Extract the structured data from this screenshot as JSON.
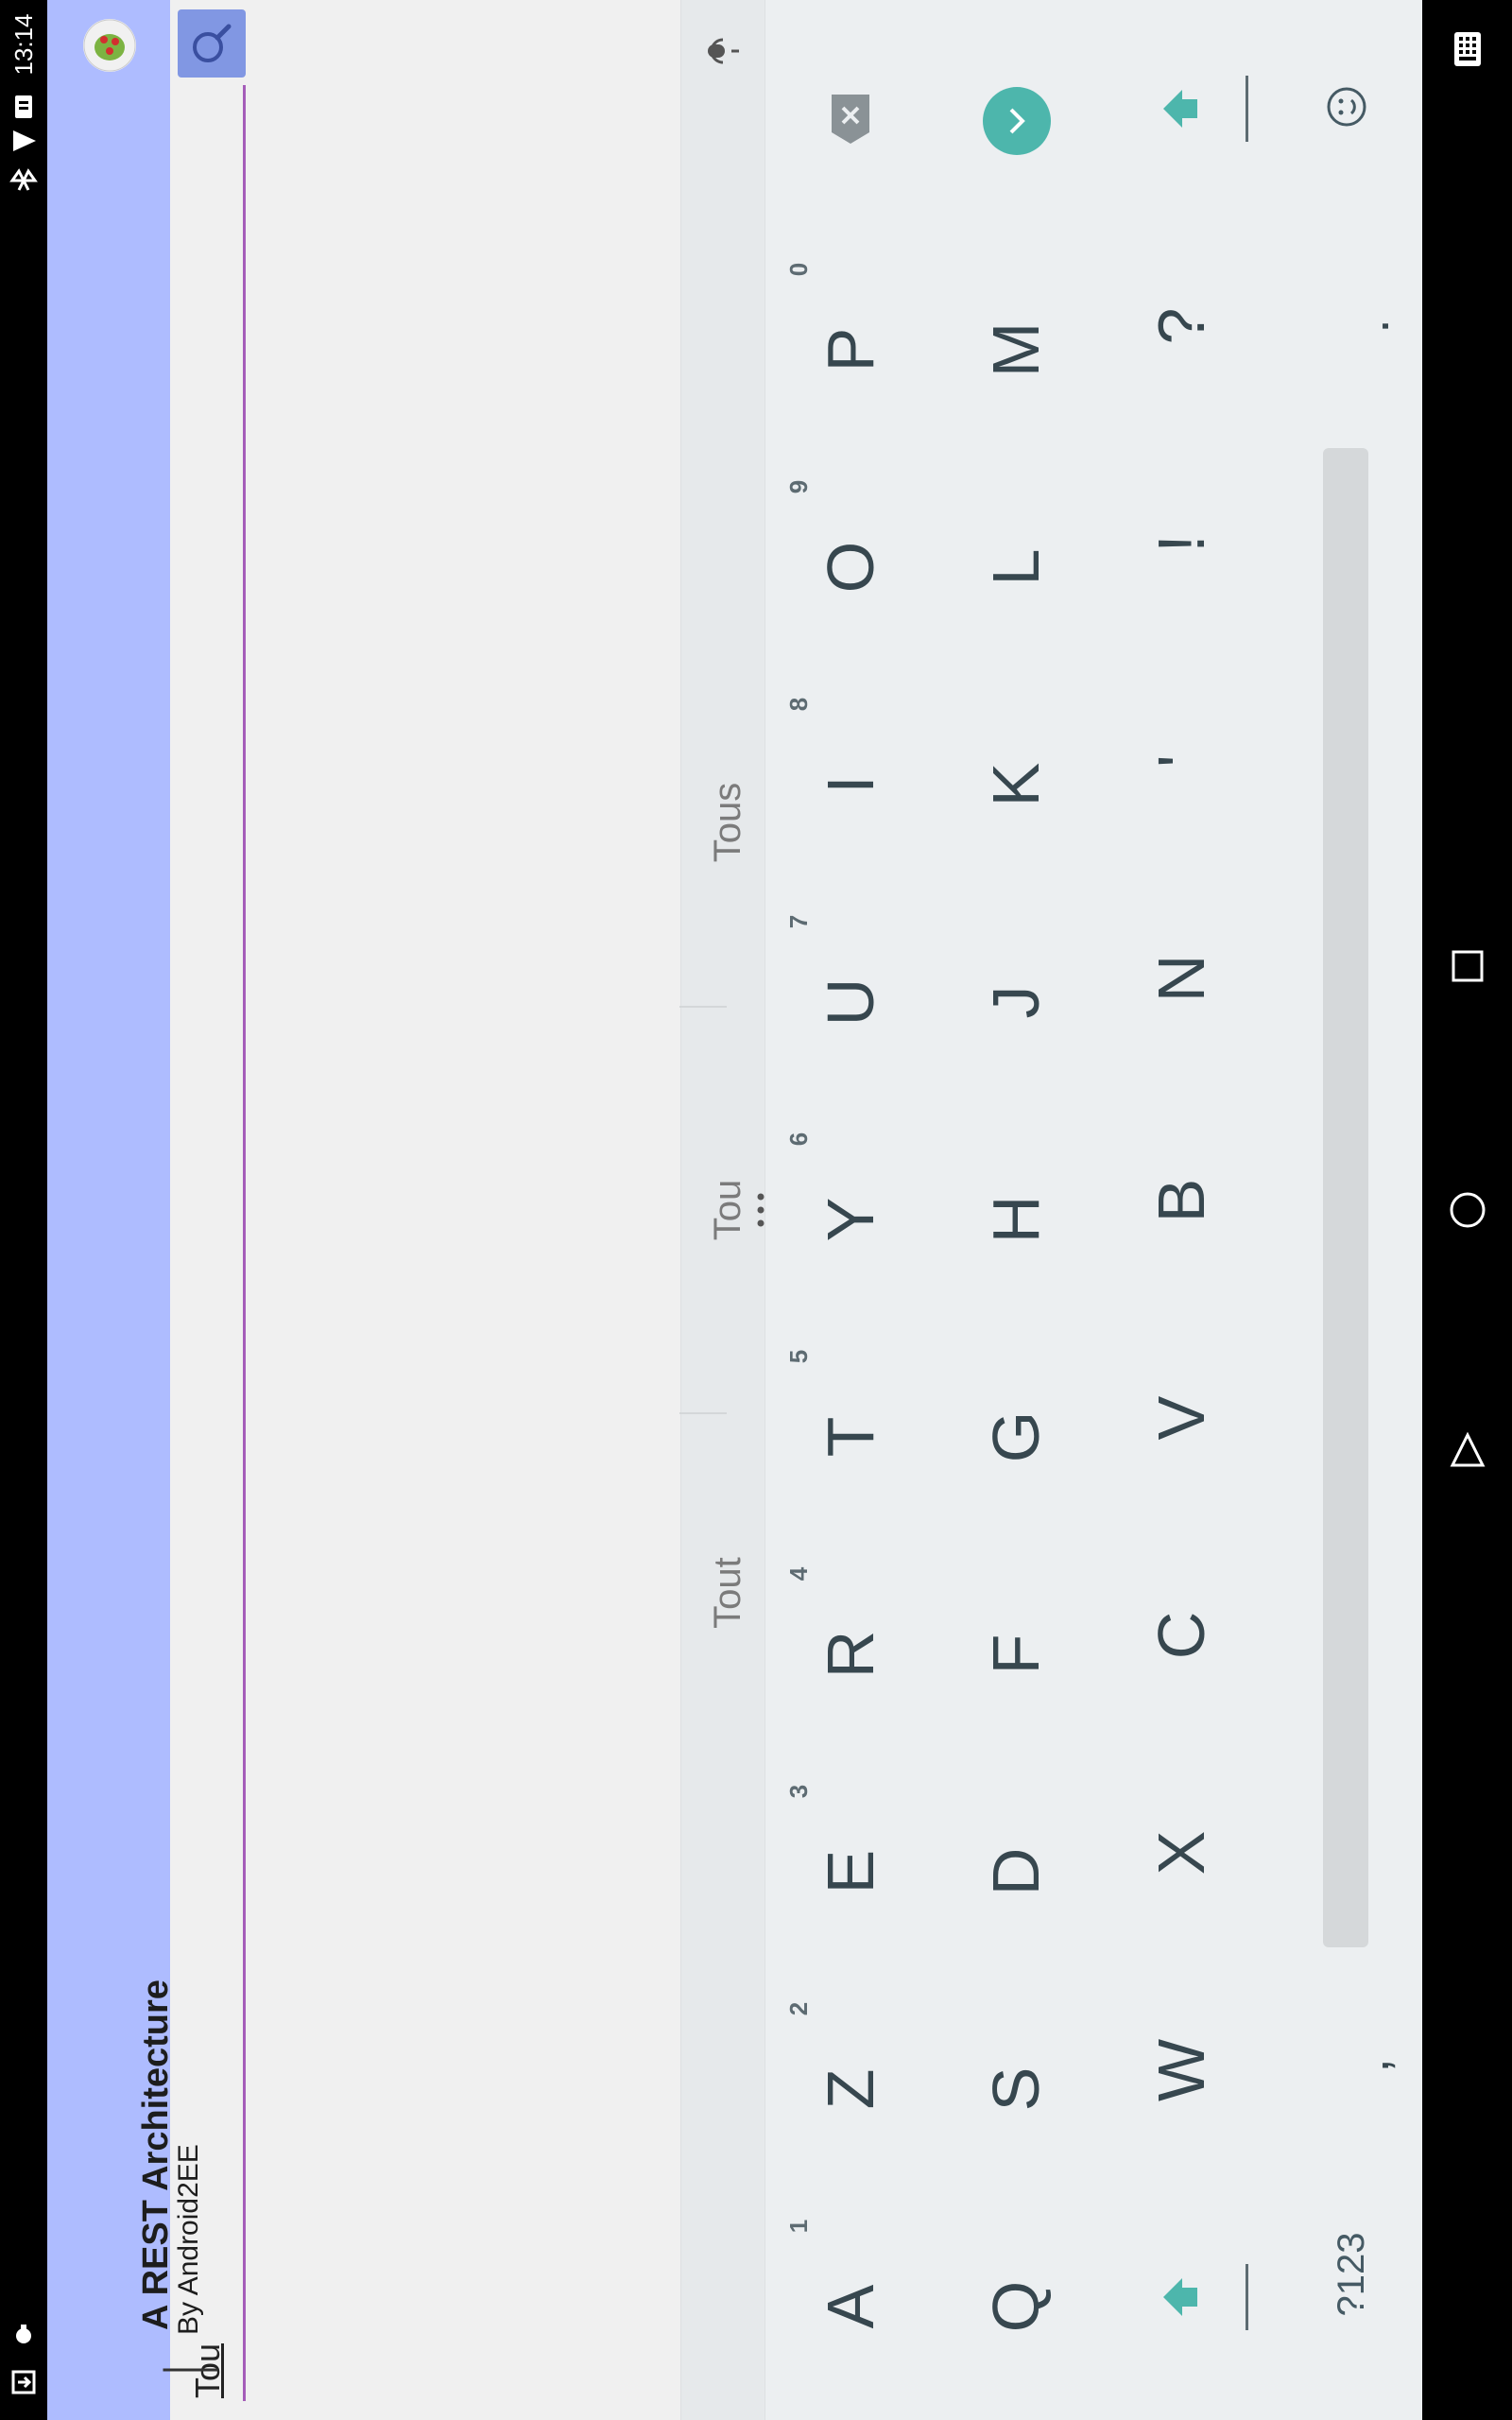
{
  "status_bar": {
    "time": "13:14",
    "icons": [
      "sim-icon",
      "sd-card-icon",
      "wifi-icon",
      "bluetooth-icon",
      "debug-icon",
      "download-icon"
    ]
  },
  "app_bar": {
    "title": "A REST Architecture",
    "subtitle": "By Android2EE"
  },
  "search": {
    "text": "Tou"
  },
  "keyboard": {
    "suggestions": [
      "Tout",
      "Tou",
      "Tous"
    ],
    "row1": [
      "A",
      "Z",
      "E",
      "R",
      "T",
      "Y",
      "U",
      "I",
      "O",
      "P"
    ],
    "row1_hints": [
      "1",
      "2",
      "3",
      "4",
      "5",
      "6",
      "7",
      "8",
      "9",
      "0"
    ],
    "row2": [
      "Q",
      "S",
      "D",
      "F",
      "G",
      "H",
      "J",
      "K",
      "L",
      "M"
    ],
    "row3": [
      "W",
      "X",
      "C",
      "V",
      "B",
      "N",
      "'",
      "!",
      "?"
    ],
    "row4_comma": ",",
    "row4_period": ".",
    "symbols_label": "?123"
  },
  "colors": {
    "app_bar": "#aebcff",
    "accent": "#a55db9",
    "keyboard_accent": "#4db6ac",
    "search_button": "#8197e3"
  }
}
